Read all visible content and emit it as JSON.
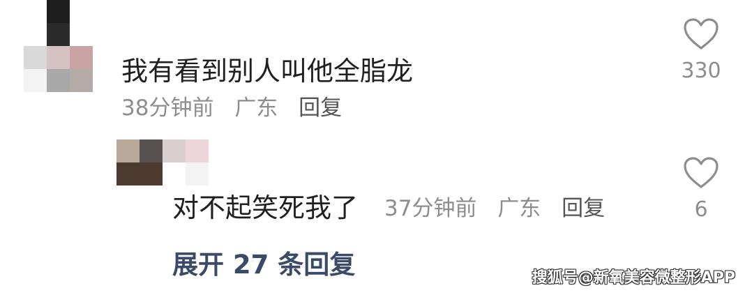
{
  "comments": [
    {
      "text": "我有看到别人叫他全脂龙",
      "time": "38分钟前",
      "location": "广东",
      "reply_label": "回复",
      "likes": "330"
    },
    {
      "text": "对不起笑死我了",
      "time": "37分钟前",
      "location": "广东",
      "reply_label": "回复",
      "likes": "6"
    }
  ],
  "expand_replies": "展开 27 条回复",
  "watermark": "搜狐号@新氧美容微整形APP",
  "icons": {
    "like": "heart-outline-icon"
  },
  "colors": {
    "text": "#1f1f1f",
    "meta": "#8d8d8d",
    "expand": "#3b4a66"
  }
}
